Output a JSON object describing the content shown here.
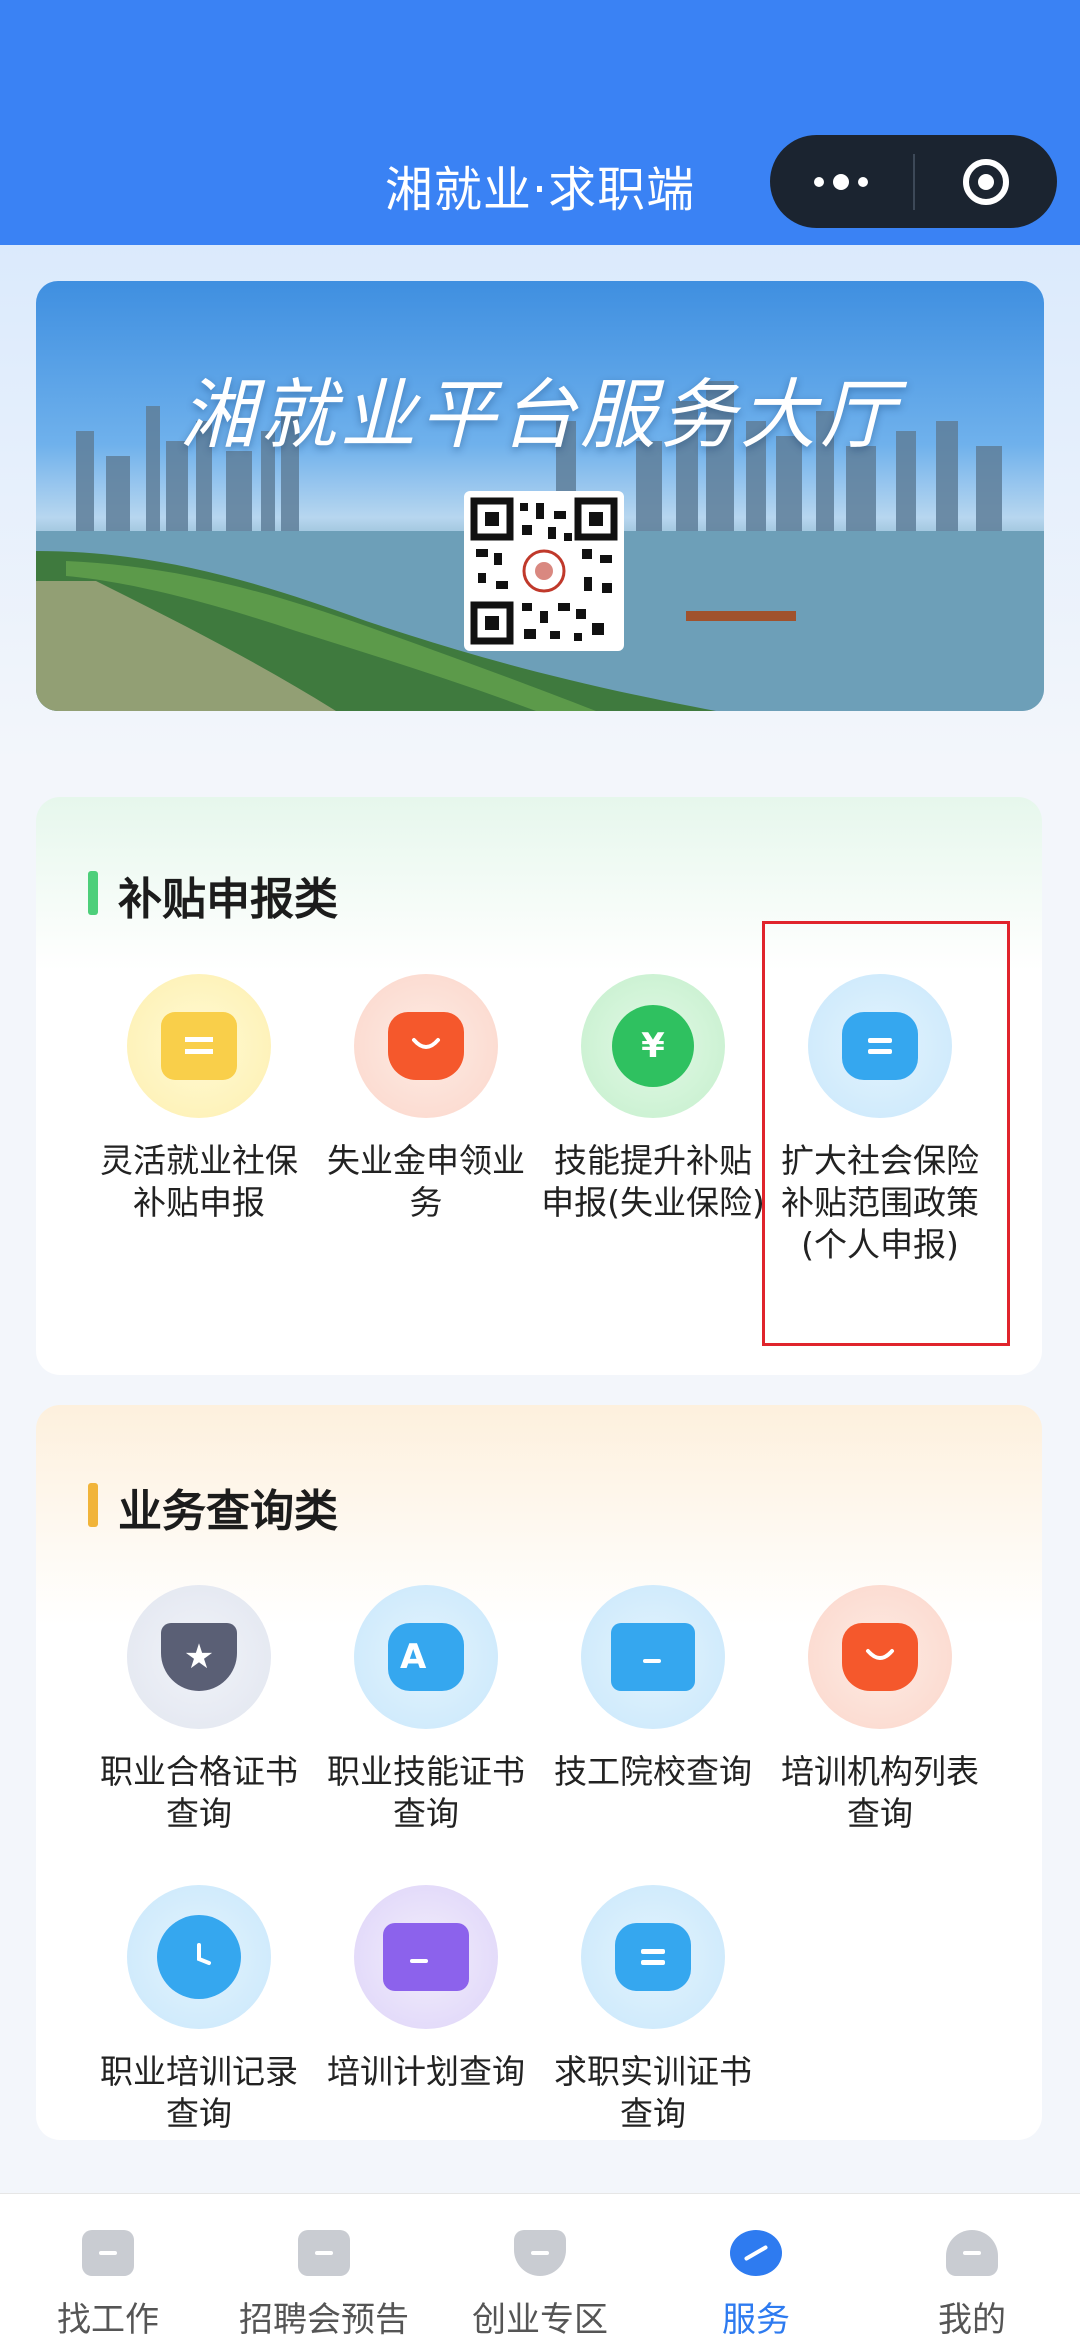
{
  "header": {
    "title": "湘就业·求职端"
  },
  "banner": {
    "title": "湘就业平台服务大厅"
  },
  "subsidy_section": {
    "title": "补贴申报类",
    "items": [
      {
        "label": "灵活就业社保补贴申报",
        "icon": "document-icon",
        "color": "#f9cf4a"
      },
      {
        "label": "失业金申领业务",
        "icon": "bag-icon",
        "color": "#f5582c"
      },
      {
        "label": "技能提升补贴申报(失业保险)",
        "icon": "money-bag-icon",
        "color": "#2fc160"
      },
      {
        "label": "扩大社会保险补贴范围政策(个人申报)",
        "icon": "card-icon",
        "color": "#35a7ef"
      }
    ]
  },
  "query_section": {
    "title": "业务查询类",
    "items": [
      {
        "label": "职业合格证书查询",
        "icon": "badge-star-icon",
        "color": "#5a5f75"
      },
      {
        "label": "职业技能证书查询",
        "icon": "certificate-a-icon",
        "color": "#35a7ef"
      },
      {
        "label": "技工院校查询",
        "icon": "folder-icon",
        "color": "#35a7ef"
      },
      {
        "label": "培训机构列表查询",
        "icon": "bag-icon",
        "color": "#f5582c"
      },
      {
        "label": "职业培训记录查询",
        "icon": "clock-icon",
        "color": "#35a7ef"
      },
      {
        "label": "培训计划查询",
        "icon": "folder-icon",
        "color": "#8c62ec"
      },
      {
        "label": "求职实训证书查询",
        "icon": "card-icon",
        "color": "#35a7ef"
      }
    ]
  },
  "tabbar": {
    "items": [
      {
        "label": "找工作",
        "icon": "briefcase-icon",
        "active": false
      },
      {
        "label": "招聘会预告",
        "icon": "notice-icon",
        "active": false
      },
      {
        "label": "创业专区",
        "icon": "shield-icon",
        "active": false
      },
      {
        "label": "服务",
        "icon": "planet-icon",
        "active": true
      },
      {
        "label": "我的",
        "icon": "user-icon",
        "active": false
      }
    ]
  }
}
